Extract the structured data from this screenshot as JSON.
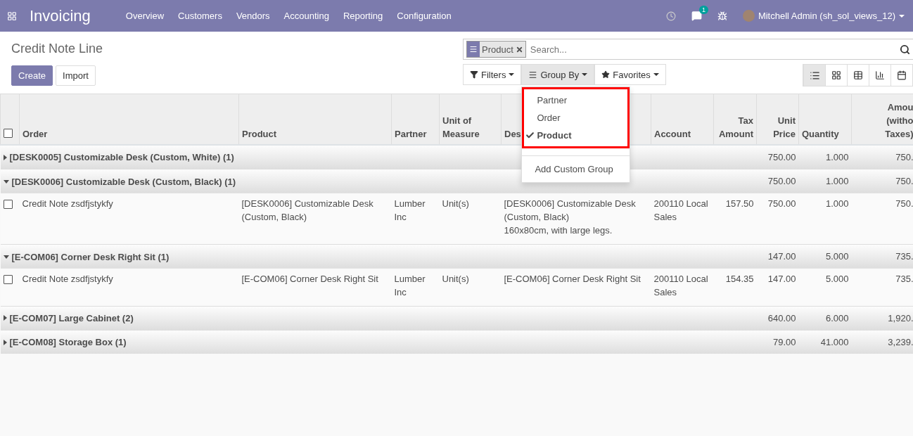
{
  "navbar": {
    "app_title": "Invoicing",
    "menu": [
      "Overview",
      "Customers",
      "Vendors",
      "Accounting",
      "Reporting",
      "Configuration"
    ],
    "messages_count": "1",
    "user": "Mitchell Admin (sh_sol_views_12)"
  },
  "control_panel": {
    "breadcrumb": "Credit Note Line",
    "buttons": [
      "Create",
      "Import"
    ],
    "search": {
      "facets": [
        {
          "label": "Product"
        }
      ],
      "placeholder": "Search..."
    },
    "search_menus": [
      {
        "kind": "filter",
        "label": "Filters",
        "open": false
      },
      {
        "kind": "groupby",
        "label": "Group By",
        "open": true
      },
      {
        "kind": "favorites",
        "label": "Favorites",
        "open": false
      }
    ],
    "views": [
      {
        "kind": "list",
        "selected": true
      },
      {
        "kind": "kanban",
        "selected": false
      },
      {
        "kind": "pivot",
        "selected": false
      },
      {
        "kind": "graph",
        "selected": false
      },
      {
        "kind": "calendar",
        "selected": false
      }
    ]
  },
  "group_by_menu": {
    "items": [
      {
        "label": "Partner",
        "checked": false
      },
      {
        "label": "Order",
        "checked": false
      },
      {
        "label": "Product",
        "checked": true
      }
    ],
    "custom_label": "Add Custom Group"
  },
  "table": {
    "select_all_checked": false,
    "columns": [
      "Order",
      "Product",
      "Partner",
      "Unit of\nMeasure",
      "Des",
      "Account",
      "Tax\nAmount",
      "Unit\nPrice",
      "Quantity",
      "Amou\n(witho\nTaxes)"
    ],
    "groups": [
      {
        "label": "[DESK0005] Customizable Desk (Custom, White) (1)",
        "expanded": false,
        "unit_price": "750.00",
        "quantity": "1.000",
        "amount": "750."
      },
      {
        "label": "[DESK0006] Customizable Desk (Custom, Black) (1)",
        "expanded": true,
        "unit_price": "750.00",
        "quantity": "1.000",
        "amount": "750.",
        "rows": [
          {
            "checked": false,
            "order": "Credit Note zsdfjstykfy",
            "product": "[DESK0006] Customizable Desk (Custom, Black)",
            "partner": "Lumber Inc",
            "uom": "Unit(s)",
            "description": "[DESK0006] Customizable Desk (Custom, Black)\n160x80cm, with large legs.",
            "account": "200110 Local Sales",
            "tax_amount": "157.50",
            "unit_price": "750.00",
            "quantity": "1.000",
            "amount": "750."
          }
        ]
      },
      {
        "label": "[E-COM06] Corner Desk Right Sit (1)",
        "expanded": true,
        "unit_price": "147.00",
        "quantity": "5.000",
        "amount": "735.",
        "rows": [
          {
            "checked": false,
            "order": "Credit Note zsdfjstykfy",
            "product": "[E-COM06] Corner Desk Right Sit",
            "partner": "Lumber Inc",
            "uom": "Unit(s)",
            "description": "[E-COM06] Corner Desk Right Sit",
            "account": "200110 Local Sales",
            "tax_amount": "154.35",
            "unit_price": "147.00",
            "quantity": "5.000",
            "amount": "735."
          }
        ]
      },
      {
        "label": "[E-COM07] Large Cabinet (2)",
        "expanded": false,
        "unit_price": "640.00",
        "quantity": "6.000",
        "amount": "1,920."
      },
      {
        "label": "[E-COM08] Storage Box (1)",
        "expanded": false,
        "unit_price": "79.00",
        "quantity": "41.000",
        "amount": "3,239."
      }
    ]
  }
}
